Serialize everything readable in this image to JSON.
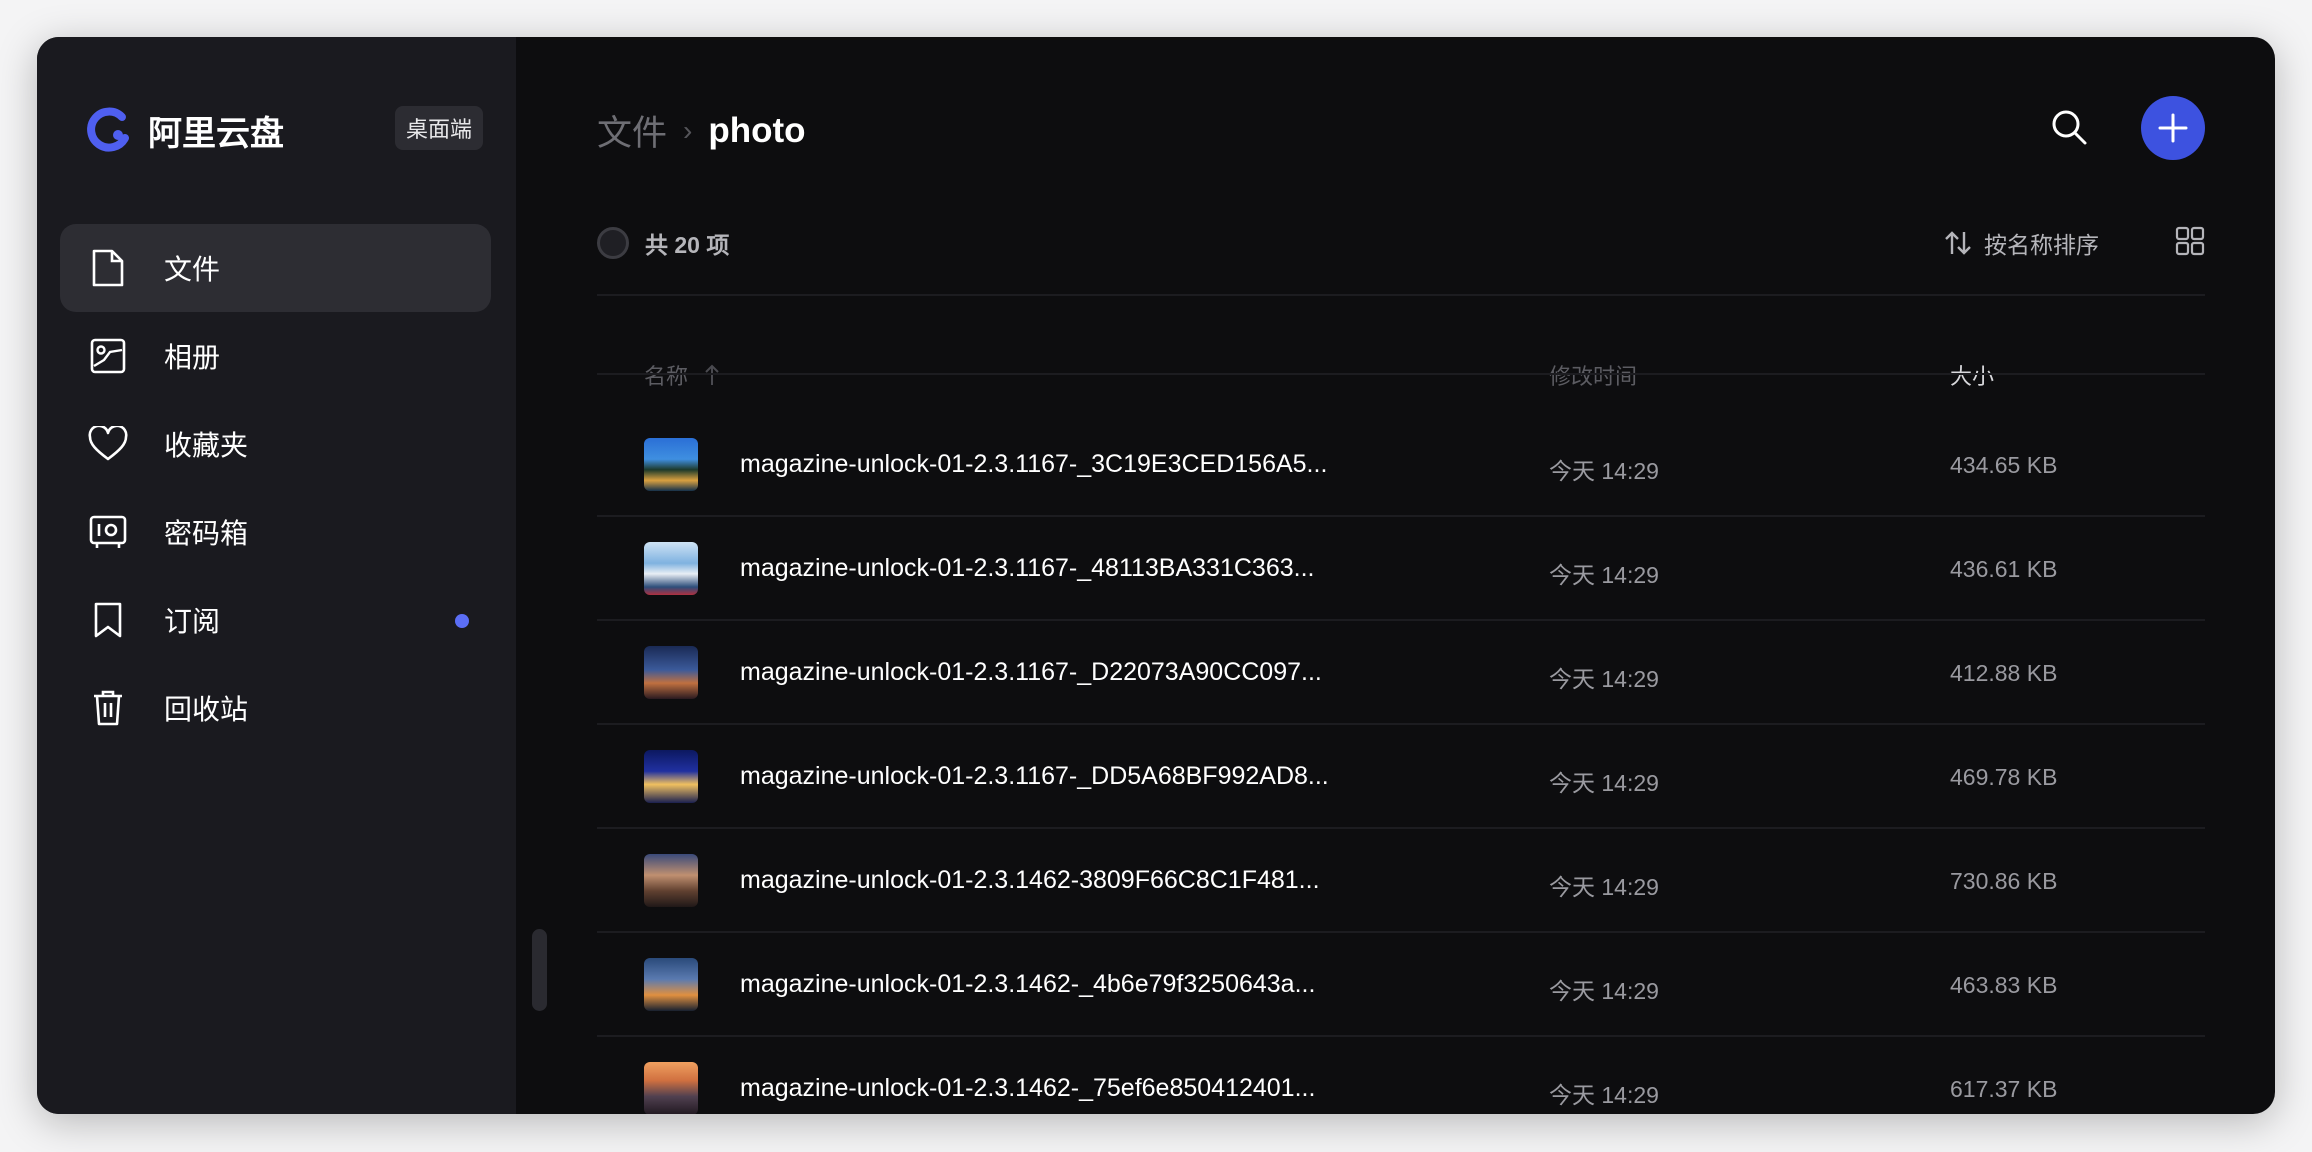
{
  "app": {
    "name": "阿里云盘",
    "badge": "桌面端",
    "brand_color": "#4f5ff0"
  },
  "sidebar": {
    "items": [
      {
        "label": "文件",
        "icon": "file-icon",
        "active": true
      },
      {
        "label": "相册",
        "icon": "album-icon"
      },
      {
        "label": "收藏夹",
        "icon": "heart-icon"
      },
      {
        "label": "密码箱",
        "icon": "safe-icon"
      },
      {
        "label": "订阅",
        "icon": "bookmark-icon",
        "has_dot": true
      },
      {
        "label": "回收站",
        "icon": "trash-icon"
      }
    ]
  },
  "breadcrumb": {
    "parent": "文件",
    "separator": "›",
    "current": "photo"
  },
  "toolbar": {
    "count": "共 20 项",
    "sort_label": "按名称排序",
    "accent": "#3d52e0"
  },
  "table": {
    "columns": {
      "name": "名称",
      "modified": "修改时间",
      "size": "大小"
    },
    "rows": [
      {
        "name": "magazine-unlock-01-2.3.1167-_3C19E3CED156A5...",
        "modified": "今天 14:29",
        "size": "434.65 KB"
      },
      {
        "name": "magazine-unlock-01-2.3.1167-_48113BA331C363...",
        "modified": "今天 14:29",
        "size": "436.61 KB"
      },
      {
        "name": "magazine-unlock-01-2.3.1167-_D22073A90CC097...",
        "modified": "今天 14:29",
        "size": "412.88 KB"
      },
      {
        "name": "magazine-unlock-01-2.3.1167-_DD5A68BF992AD8...",
        "modified": "今天 14:29",
        "size": "469.78 KB"
      },
      {
        "name": "magazine-unlock-01-2.3.1462-3809F66C8C1F481...",
        "modified": "今天 14:29",
        "size": "730.86 KB"
      },
      {
        "name": "magazine-unlock-01-2.3.1462-_4b6e79f3250643a...",
        "modified": "今天 14:29",
        "size": "463.83 KB"
      },
      {
        "name": "magazine-unlock-01-2.3.1462-_75ef6e850412401...",
        "modified": "今天 14:29",
        "size": "617.37 KB"
      }
    ]
  }
}
